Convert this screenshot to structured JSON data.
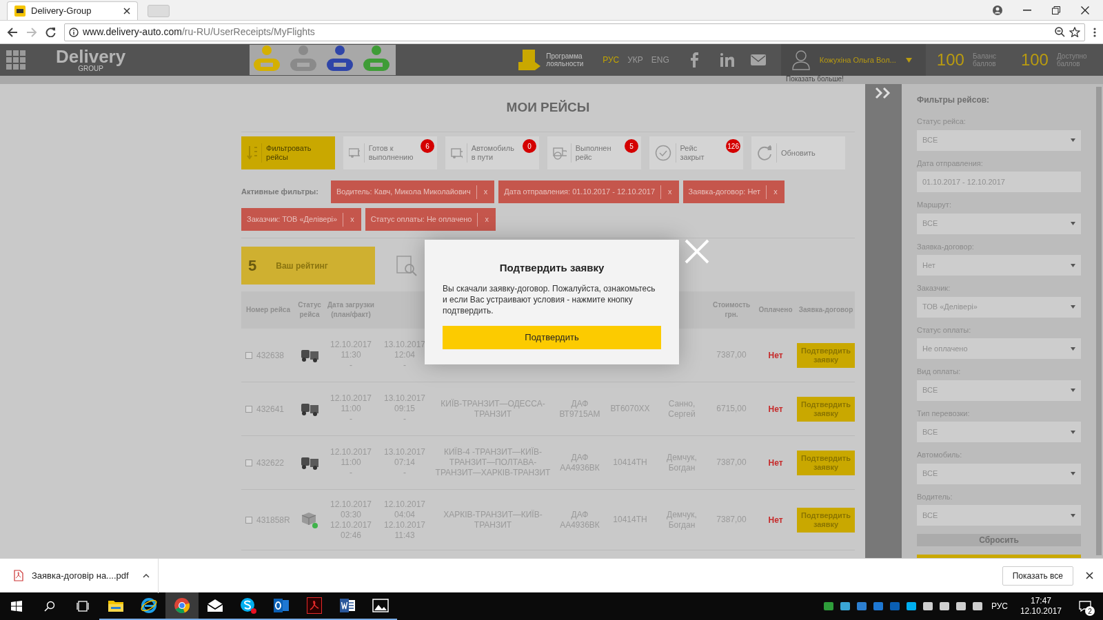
{
  "browser": {
    "tab_title": "Delivery-Group",
    "url_host": "www.delivery-auto.com",
    "url_path": "/ru-RU/UserReceipts/MyFlights"
  },
  "site_header": {
    "logo": "Delivery",
    "logo_sub": "GROUP",
    "loyalty": "Программа лояльности",
    "languages": [
      {
        "label": "РУС",
        "selected": true
      },
      {
        "label": "УКР",
        "selected": false
      },
      {
        "label": "ENG",
        "selected": false
      }
    ],
    "user": "Кожухіна Ольга Вол...",
    "balances": [
      {
        "value": "100",
        "label": "Баланс баллов"
      },
      {
        "value": "100",
        "label": "Доступно баллов"
      }
    ],
    "show_more": "Показать больше!"
  },
  "page": {
    "title": "МОИ РЕЙСЫ",
    "actions": [
      {
        "kind": "filter",
        "label": "Фильтровать рейсы",
        "selected": true
      },
      {
        "kind": "ready",
        "label": "Готов к выполнению",
        "badge": "6",
        "selected": false
      },
      {
        "kind": "en_route",
        "label": "Автомобиль в пути",
        "badge": "0",
        "selected": false
      },
      {
        "kind": "done",
        "label": "Выполнен рейс",
        "badge": "5",
        "selected": false
      },
      {
        "kind": "closed",
        "label": "Рейс закрыт",
        "badge": "126",
        "selected": false
      },
      {
        "kind": "refresh",
        "label": "Обновить",
        "selected": false
      }
    ],
    "active_filters_label": "Активные фильтры:",
    "active_filters": [
      {
        "label": "Водитель: Кавч, Микола Миколайович",
        "remove": "x"
      },
      {
        "label": "Дата отправления: 01.10.2017 - 12.10.2017",
        "remove": "x"
      },
      {
        "label": "Заявка-договор: Нет",
        "remove": "x"
      },
      {
        "label": "Заказчик: ТОВ «Делівері»",
        "remove": "x"
      },
      {
        "label": "Статус оплаты: Не оплачено",
        "remove": "x"
      }
    ],
    "rating": {
      "value": "5",
      "label": "Ваш рейтинг"
    },
    "table": {
      "header": {
        "number": "Номер рейса",
        "status": "Статус рейса",
        "loaded": "Дата загрузки (план/факт)",
        "cost": "Стоимость грн.",
        "paid": "Оплачено",
        "contract": "Заявка-договор"
      },
      "rows": [
        {
          "checked": false,
          "number": "432638",
          "kind": "truck",
          "loaded": [
            "12.10.2017",
            "11:30",
            "-"
          ],
          "unloaded": [
            "13.10.2017",
            "12:04",
            "-"
          ],
          "cost": "7387,00",
          "paid": "Нет",
          "action": "Подтвердить заявку"
        },
        {
          "checked": false,
          "number": "432641",
          "kind": "truck",
          "loaded": [
            "12.10.2017",
            "11:00",
            "-"
          ],
          "unloaded": [
            "13.10.2017",
            "09:15",
            "-"
          ],
          "route": "КИЇВ-ТРАНЗИТ—ОДЕССА-ТРАНЗИТ",
          "car": "ДАФ ВТ9715АМ",
          "plate": "ВТ6070ХХ",
          "driver": "Санно, Сергей",
          "cost": "6715,00",
          "paid": "Нет",
          "action": "Подтвердить заявку"
        },
        {
          "checked": false,
          "number": "432622",
          "kind": "truck",
          "loaded": [
            "12.10.2017",
            "11:00",
            "-"
          ],
          "unloaded": [
            "13.10.2017",
            "07:14",
            "-"
          ],
          "route": "КИЇВ-4 -ТРАНЗИТ—КИЇВ-ТРАНЗИТ—ПОЛТАВА-ТРАНЗИТ—ХАРКІВ-ТРАНЗИТ",
          "car": "ДАФ АА4936ВК",
          "plate": "10414ТН",
          "driver": "Демчук, Богдан",
          "cost": "7387,00",
          "paid": "Нет",
          "action": "Подтвердить заявку"
        },
        {
          "checked": false,
          "number": "431858R",
          "kind": "loaded",
          "loaded": [
            "12.10.2017",
            "03:30",
            "12.10.2017",
            "02:46"
          ],
          "unloaded": [
            "12.10.2017",
            "04:04",
            "12.10.2017",
            "11:43"
          ],
          "route": "ХАРКІВ-ТРАНЗИТ—КИЇВ-ТРАНЗИТ",
          "car": "ДАФ АА4936ВК",
          "plate": "10414ТН",
          "driver": "Демчук, Богдан",
          "cost": "7387,00",
          "paid": "Нет",
          "action": "Подтвердить заявку"
        }
      ]
    }
  },
  "filters_panel": {
    "title": "Фильтры рейсов:",
    "fields": [
      {
        "label": "Статус рейса:",
        "value": "ВСЕ",
        "kind": "select"
      },
      {
        "label": "Дата отправления:",
        "value": "01.10.2017 - 12.10.2017",
        "kind": "date"
      },
      {
        "label": "Маршрут:",
        "value": "ВСЕ",
        "kind": "select"
      },
      {
        "label": "Заявка-договор:",
        "value": "Нет",
        "kind": "select"
      },
      {
        "label": "Заказчик:",
        "value": "ТОВ «Делівері»",
        "kind": "select"
      },
      {
        "label": "Статус оплаты:",
        "value": "Не оплачено",
        "kind": "select"
      },
      {
        "label": "Вид оплаты:",
        "value": "ВСЕ",
        "kind": "select"
      },
      {
        "label": "Тип перевозки:",
        "value": "ВСЕ",
        "kind": "select"
      },
      {
        "label": "Автомобиль:",
        "value": "ВСЕ",
        "kind": "select"
      },
      {
        "label": "Водитель:",
        "value": "ВСЕ",
        "kind": "select"
      }
    ],
    "reset": "Сбросить"
  },
  "modal": {
    "title": "Подтвердить заявку",
    "text": "Вы скачали заявку-договор. Пожалуйста, ознакомьтесь и если Вас устраивают условия - нажмите кнопку подтвердить.",
    "button": "Подтвердить"
  },
  "download_bar": {
    "file": "Заявка-договір на....pdf",
    "show_all": "Показать все"
  },
  "taskbar": {
    "apps": [
      {
        "kind": "explorer",
        "selected": false
      },
      {
        "kind": "ie",
        "selected": false
      },
      {
        "kind": "chrome",
        "selected": true
      },
      {
        "kind": "mail",
        "selected": false
      },
      {
        "kind": "skype",
        "selected": false
      },
      {
        "kind": "outlook",
        "selected": false
      },
      {
        "kind": "acrobat",
        "selected": false
      },
      {
        "kind": "word",
        "selected": false
      },
      {
        "kind": "photos",
        "selected": false
      }
    ],
    "language": "РУС",
    "time": "17:47",
    "date": "12.10.2017",
    "notifications": "2"
  }
}
